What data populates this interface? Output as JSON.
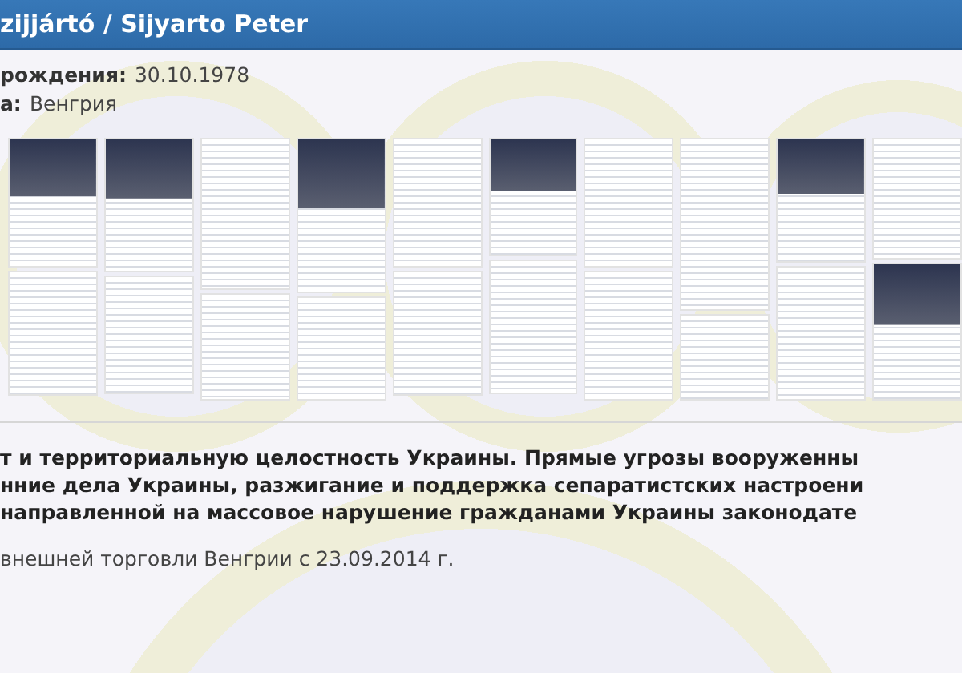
{
  "header": {
    "title": "zijjártó / Sijyarto Peter"
  },
  "fields": [
    {
      "label": "рождения:",
      "value": "30.10.1978"
    },
    {
      "label": "а:",
      "value": "Венгрия"
    }
  ],
  "description": {
    "lines": [
      "т и территориальную целостность Украины. Прямые угрозы вооруженны",
      "нние дела Украины, разжигание и поддержка сепаратистских настроени",
      "направленной на массовое нарушение гражданами Украины законодате"
    ]
  },
  "position": "внешней торговли Венгрии с 23.09.2014 г."
}
